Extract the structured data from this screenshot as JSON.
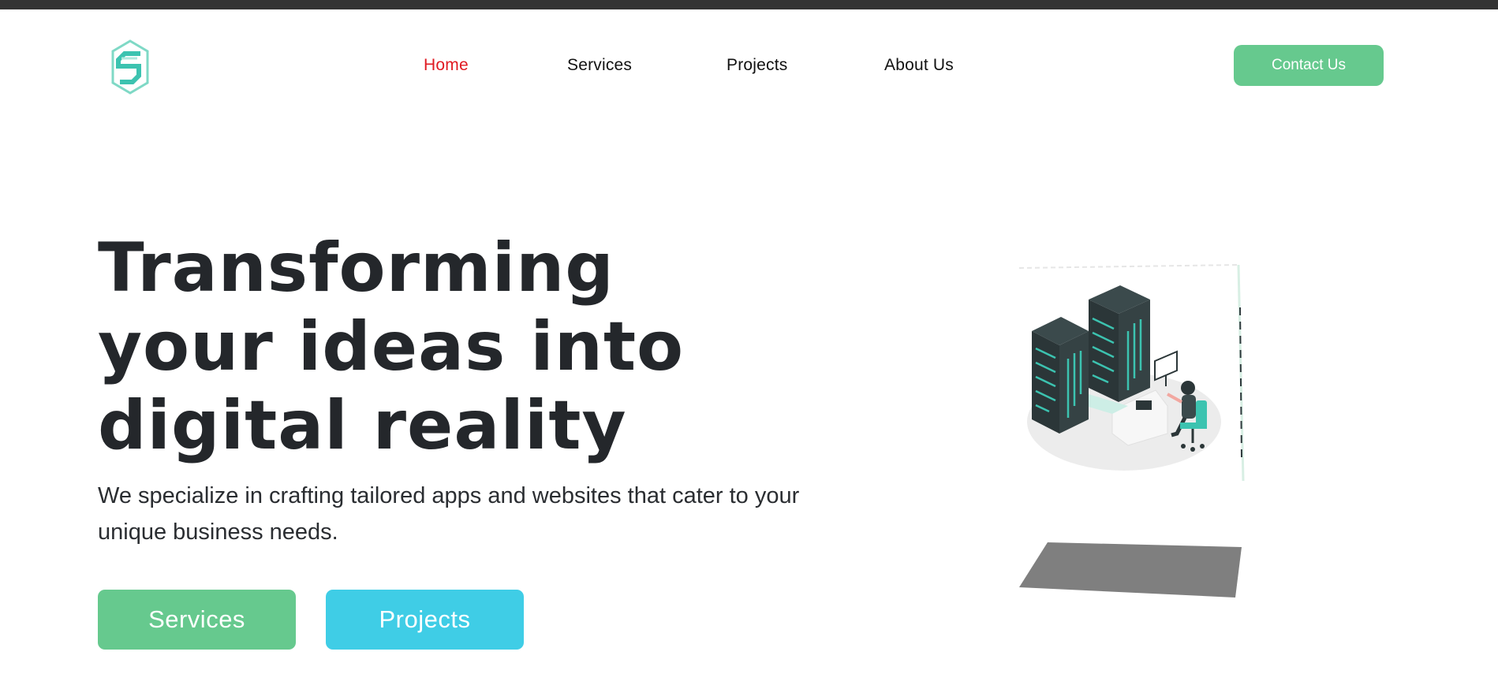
{
  "nav": {
    "items": [
      {
        "label": "Home",
        "active": true
      },
      {
        "label": "Services",
        "active": false
      },
      {
        "label": "Projects",
        "active": false
      },
      {
        "label": "About Us",
        "active": false
      }
    ],
    "contact_label": "Contact Us"
  },
  "hero": {
    "title": "Transforming your ideas into digital reality",
    "subtitle": "We specialize in crafting tailored apps and websites that cater to your unique business needs.",
    "buttons": {
      "services": "Services",
      "projects": "Projects"
    }
  },
  "colors": {
    "accent_green": "#66c98e",
    "accent_cyan": "#3fcde6",
    "active_nav": "#e01a22",
    "logo_teal": "#3cc3b0"
  },
  "icons": {
    "logo": "s-hexagon-logo",
    "illustration": "server-room-illustration"
  }
}
